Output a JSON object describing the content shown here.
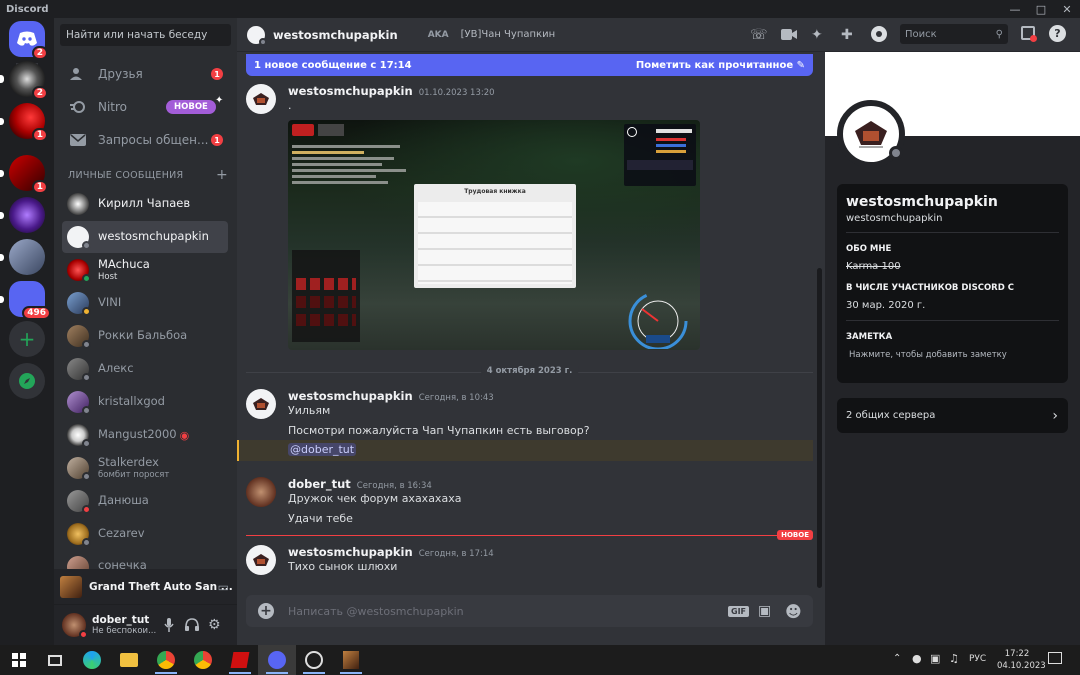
{
  "window": {
    "brand": "Discord"
  },
  "servers": [
    {
      "badge": "2"
    },
    {
      "badge": "2"
    },
    {
      "badge": "1"
    },
    {
      "badge": "1"
    },
    {
      "badge": ""
    },
    {
      "badge": ""
    },
    {
      "badge": "496"
    }
  ],
  "sidebar": {
    "search_placeholder": "Найти или начать беседу",
    "nav": [
      {
        "label": "Друзья",
        "badge": "1"
      },
      {
        "label": "Nitro",
        "tag": "НОВОЕ"
      },
      {
        "label": "Запросы общен...",
        "badge": "1"
      }
    ],
    "section_title": "ЛИЧНЫЕ СООБЩЕНИЯ",
    "dms": [
      {
        "name": "Кирилл Чапаев",
        "sub": ""
      },
      {
        "name": "westosmchupapkin",
        "sub": ""
      },
      {
        "name": "MAchuca",
        "sub": "Host"
      },
      {
        "name": "VINI",
        "sub": ""
      },
      {
        "name": "Рокки Бальбоа",
        "sub": ""
      },
      {
        "name": "Алекс",
        "sub": ""
      },
      {
        "name": "kristallxgod",
        "sub": ""
      },
      {
        "name": "Mangust2000",
        "sub": ""
      },
      {
        "name": "Stalkerdex",
        "sub": "бомбит поросят"
      },
      {
        "name": "Данюша",
        "sub": ""
      },
      {
        "name": "Cezarev",
        "sub": ""
      },
      {
        "name": "сонечка",
        "sub": ""
      }
    ],
    "activity": "Grand Theft Auto San ...",
    "user": {
      "name": "dober_tut",
      "status": "Не беспокои..."
    }
  },
  "chat": {
    "header_name": "westosmchupapkin",
    "aka_label": "AKA",
    "aka_value": "[УВ]Чан Чупапкин",
    "search_placeholder": "Поиск",
    "new_bar_text": "1 новое сообщение с 17:14",
    "mark_read": "Пометить как прочитанное",
    "messages": [
      {
        "author": "westosmchupapkin",
        "time": "01.10.2023 13:20",
        "lines": [
          "."
        ]
      },
      {
        "author": "westosmchupapkin",
        "time": "Сегодня, в 10:43",
        "lines": [
          "Уильям",
          "Посмотри пожалуйста Чап Чупапкин есть выговор?"
        ]
      },
      {
        "author": "dober_tut",
        "time": "Сегодня, в 16:34",
        "lines": [
          "Дружок чек форум  ахахахаха",
          "Удачи тебе"
        ]
      },
      {
        "author": "westosmchupapkin",
        "time": "Сегодня, в 17:14",
        "lines": [
          "Тихо сынок шлюхи"
        ]
      }
    ],
    "mention": "@dober_tut",
    "date_divider": "4 октября 2023 г.",
    "new_label": "НОВОЕ",
    "composer_placeholder": "Написать @westosmchupapkin",
    "gif_label": "GIF",
    "game_window_title": "Трудовая книжка"
  },
  "profile": {
    "display_name": "westosmchupapkin",
    "username": "westosmchupapkin",
    "about_title": "ОБО МНЕ",
    "about_text": "Karma 100 ",
    "member_title": "В ЧИСЛЕ УЧАСТНИКОВ DISCORD С",
    "member_since": "30 мар. 2020 г.",
    "note_title": "ЗАМЕТКА",
    "note_placeholder": "Нажмите, чтобы добавить заметку",
    "mutual": "2 общих сервера"
  },
  "taskbar": {
    "lang": "РУС",
    "time": "17:22",
    "date": "04.10.2023"
  },
  "colors": {
    "blurple": "#5865f2",
    "red": "#f23f43",
    "green": "#23a559",
    "dnd": "#f23f43",
    "idle": "#f0b232"
  }
}
